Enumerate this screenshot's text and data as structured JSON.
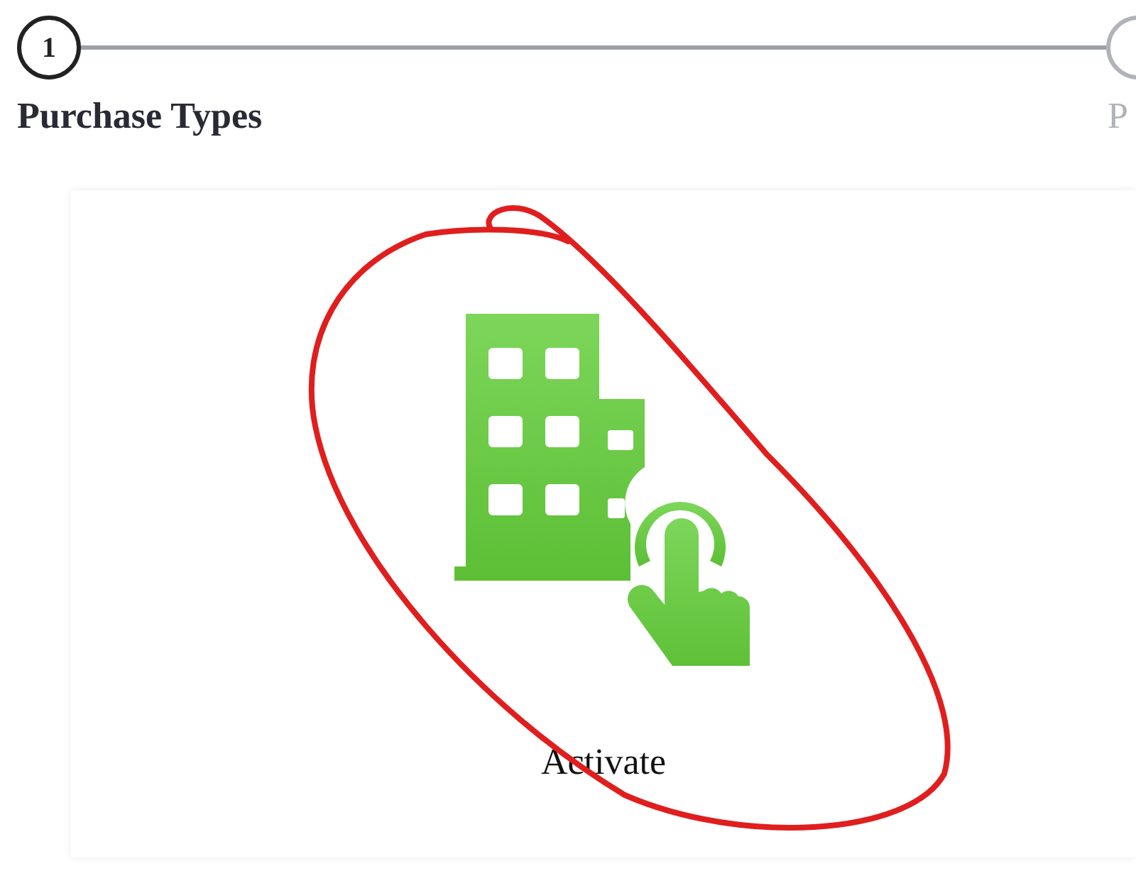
{
  "steps": [
    {
      "number": "1",
      "label": "Purchase Types",
      "selected": true
    },
    {
      "label": "P",
      "selected": false
    }
  ],
  "options": [
    {
      "label": "Activate",
      "kind": "picture-building"
    }
  ]
}
